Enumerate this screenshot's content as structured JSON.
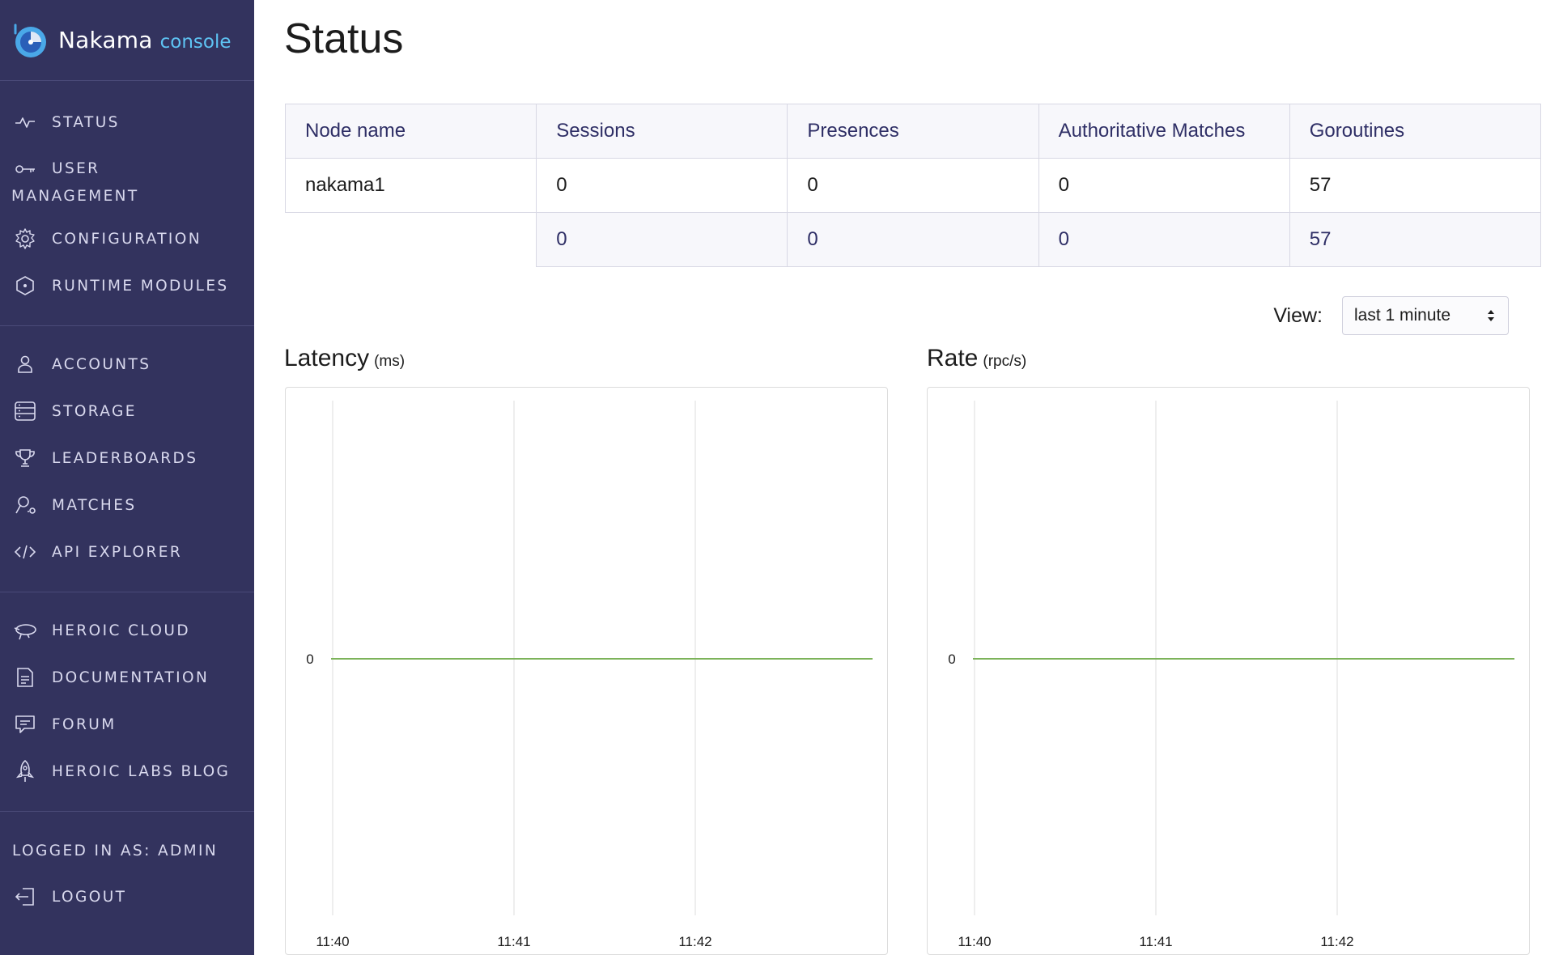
{
  "brand": {
    "name": "Nakama",
    "suffix": "console"
  },
  "sidebar": {
    "groups": [
      [
        {
          "label": "Status",
          "icon": "activity-icon"
        },
        {
          "label1": "User",
          "label2": "Management",
          "icon": "key-icon"
        },
        {
          "label": "Configuration",
          "icon": "gear-icon"
        },
        {
          "label": "Runtime Modules",
          "icon": "hexagon-icon"
        }
      ],
      [
        {
          "label": "Accounts",
          "icon": "user-icon"
        },
        {
          "label": "Storage",
          "icon": "storage-icon"
        },
        {
          "label": "Leaderboards",
          "icon": "trophy-icon"
        },
        {
          "label": "Matches",
          "icon": "matches-icon"
        },
        {
          "label": "API Explorer",
          "icon": "code-icon"
        }
      ],
      [
        {
          "label": "Heroic Cloud",
          "icon": "cloud-icon"
        },
        {
          "label": "Documentation",
          "icon": "document-icon"
        },
        {
          "label": "Forum",
          "icon": "chat-icon"
        },
        {
          "label": "Heroic Labs Blog",
          "icon": "rocket-icon"
        }
      ]
    ],
    "logged_in": "Logged in as: admin",
    "logout": "Logout"
  },
  "page": {
    "title": "Status"
  },
  "table": {
    "headers": [
      "Node name",
      "Sessions",
      "Presences",
      "Authoritative Matches",
      "Goroutines"
    ],
    "rows": [
      [
        "nakama1",
        "0",
        "0",
        "0",
        "57"
      ]
    ],
    "totals": [
      "0",
      "0",
      "0",
      "57"
    ]
  },
  "view": {
    "label": "View:",
    "selected": "last 1 minute"
  },
  "charts": {
    "latency": {
      "title": "Latency",
      "unit": "(ms)"
    },
    "rate": {
      "title": "Rate",
      "unit": "(rpc/s)"
    }
  },
  "chart_data": [
    {
      "type": "line",
      "title": "Latency (ms)",
      "x_ticks": [
        "11:40",
        "11:41",
        "11:42"
      ],
      "y_ticks": [
        "0"
      ],
      "series": [
        {
          "values": [
            0,
            0,
            0,
            0
          ]
        }
      ],
      "color": "#7cb35a",
      "grid": true
    },
    {
      "type": "line",
      "title": "Rate (rpc/s)",
      "x_ticks": [
        "11:40",
        "11:41",
        "11:42"
      ],
      "y_ticks": [
        "0"
      ],
      "series": [
        {
          "values": [
            0,
            0,
            0,
            0
          ]
        }
      ],
      "color": "#7cb35a",
      "grid": true
    }
  ]
}
